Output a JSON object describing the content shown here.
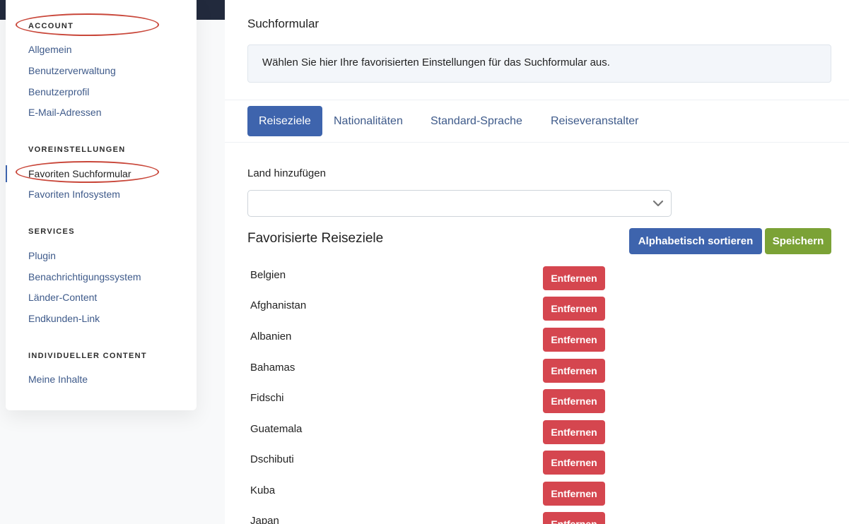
{
  "sidebar": {
    "sections": [
      {
        "title": "ACCOUNT",
        "items": [
          "Allgemein",
          "Benutzerverwaltung",
          "Benutzerprofil",
          "E-Mail-Adressen"
        ]
      },
      {
        "title": "VOREINSTELLUNGEN",
        "items": [
          "Favoriten Suchformular",
          "Favoriten Infosystem"
        ]
      },
      {
        "title": "SERVICES",
        "items": [
          "Plugin",
          "Benachrichtigungssystem",
          "Länder-Content",
          "Endkunden-Link"
        ]
      },
      {
        "title": "INDIVIDUELLER CONTENT",
        "items": [
          "Meine Inhalte"
        ]
      }
    ],
    "active_item": "Favoriten Suchformular"
  },
  "main": {
    "heading": "Suchformular",
    "info_text": "Wählen Sie hier Ihre favorisierten Einstellungen für das Suchformular aus.",
    "tabs": [
      "Reiseziele",
      "Nationalitäten",
      "Standard-Sprache",
      "Reiseveranstalter"
    ],
    "active_tab": "Reiseziele",
    "add_country_label": "Land hinzufügen",
    "add_country_value": "",
    "favorites_title": "Favorisierte Reiseziele",
    "sort_button": "Alphabetisch sortieren",
    "save_button": "Speichern",
    "remove_label": "Entfernen",
    "countries": [
      "Belgien",
      "Afghanistan",
      "Albanien",
      "Bahamas",
      "Fidschi",
      "Guatemala",
      "Dschibuti",
      "Kuba",
      "Japan"
    ]
  },
  "colors": {
    "primary": "#3e64ad",
    "success": "#7ba236",
    "danger": "#d5464f",
    "annotation": "#c9473a"
  },
  "icons": {
    "select_toggle": "chevron-down-icon"
  }
}
